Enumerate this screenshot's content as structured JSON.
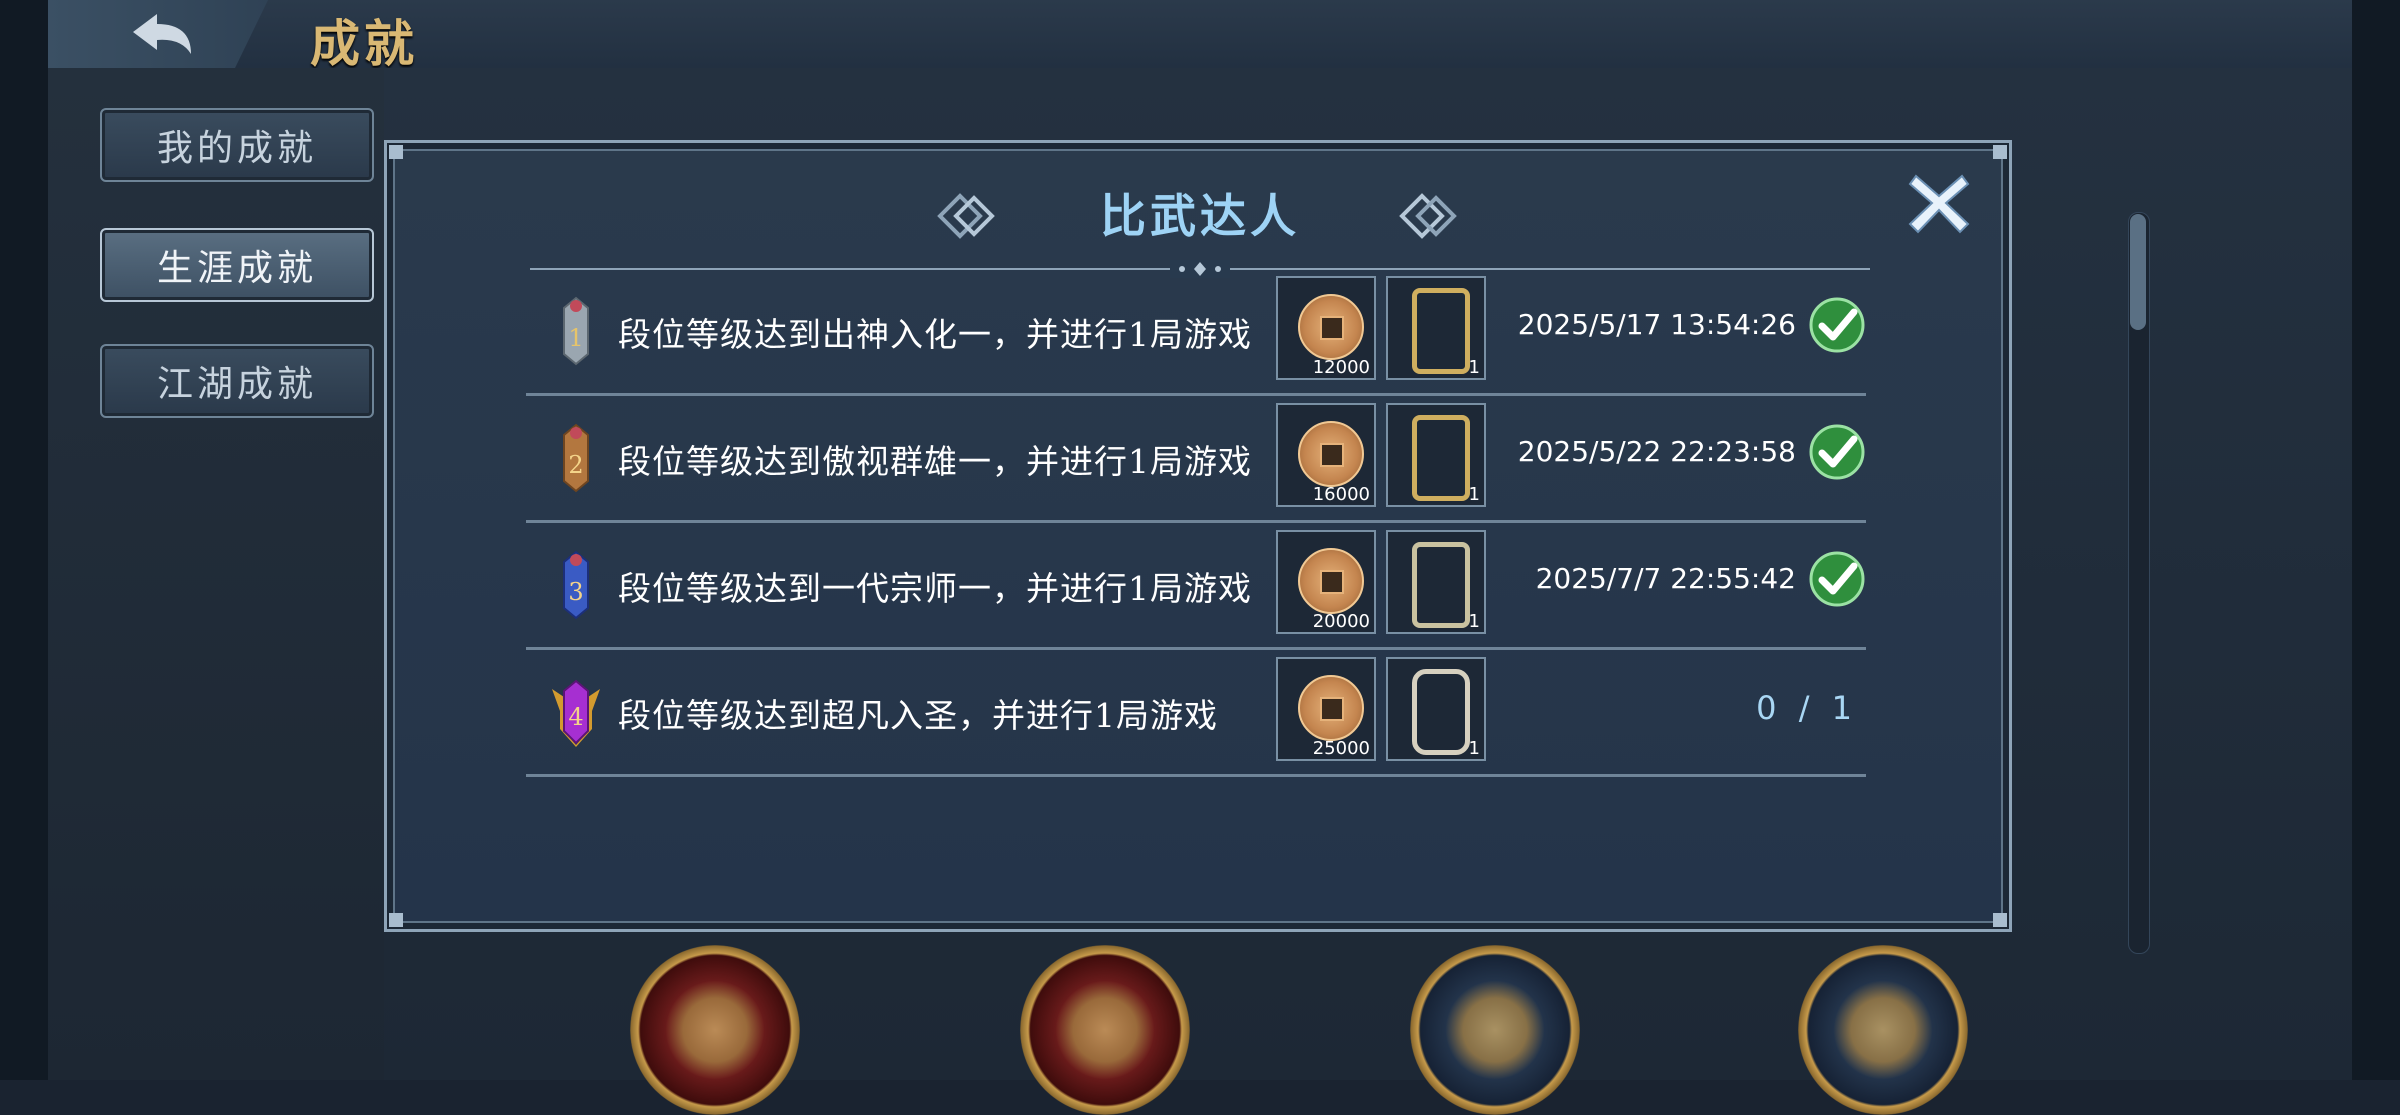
{
  "header": {
    "title": "成就",
    "back_icon": "back-arrow-icon"
  },
  "sidebar": {
    "items": [
      {
        "label": "我的成就",
        "active": false
      },
      {
        "label": "生涯成就",
        "active": true
      },
      {
        "label": "江湖成就",
        "active": false
      }
    ]
  },
  "modal": {
    "title": "比武达人",
    "close_icon": "close-icon",
    "rows": [
      {
        "rank": "1",
        "description": "段位等级达到出神入化一，并进行1局游戏",
        "reward_coin_count": "12000",
        "reward_frame_count": "1",
        "completed_time": "2025/5/17 13:54:26",
        "completed": true
      },
      {
        "rank": "2",
        "description": "段位等级达到傲视群雄一，并进行1局游戏",
        "reward_coin_count": "16000",
        "reward_frame_count": "1",
        "completed_time": "2025/5/22 22:23:58",
        "completed": true
      },
      {
        "rank": "3",
        "description": "段位等级达到一代宗师一，并进行1局游戏",
        "reward_coin_count": "20000",
        "reward_frame_count": "1",
        "completed_time": "2025/7/7 22:55:42",
        "completed": true
      },
      {
        "rank": "4",
        "description": "段位等级达到超凡入圣，并进行1局游戏",
        "reward_coin_count": "25000",
        "reward_frame_count": "1",
        "progress": "0 / 1",
        "completed": false
      }
    ]
  },
  "colors": {
    "accent_title": "#9ed3f5",
    "header_gold": "#d9b874",
    "check_green": "#3fae4e"
  }
}
